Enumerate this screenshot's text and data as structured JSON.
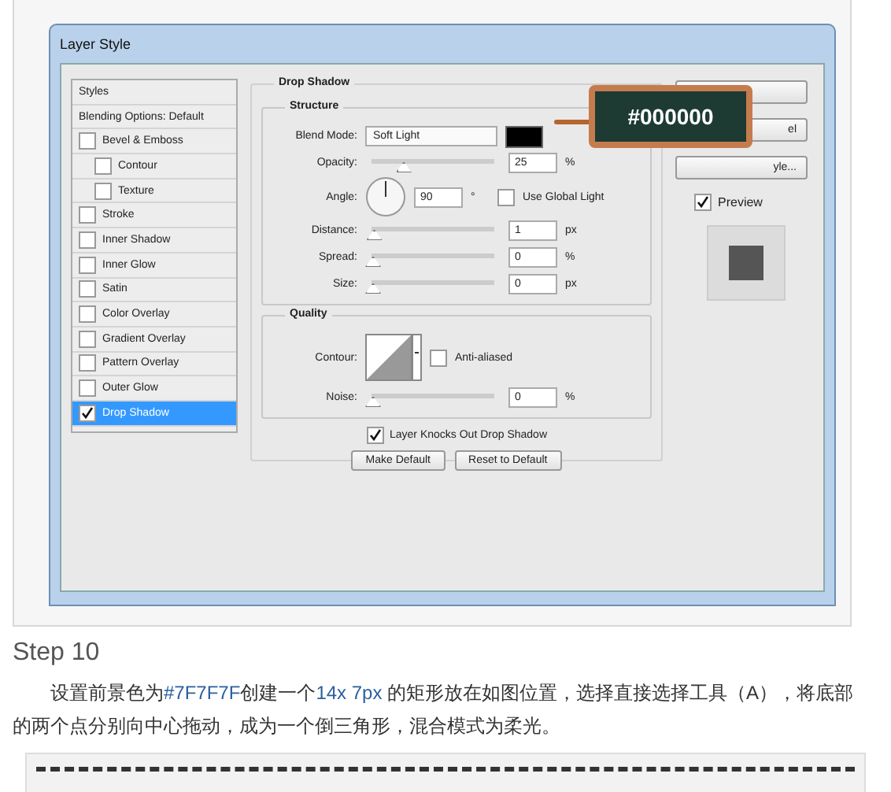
{
  "dialog": {
    "title": "Layer Style",
    "styles_header": "Styles",
    "blending_options": "Blending Options: Default",
    "style_items": [
      {
        "label": "Bevel & Emboss",
        "checked": false,
        "selected": false,
        "children": [
          {
            "label": "Contour",
            "checked": false,
            "selected": false
          },
          {
            "label": "Texture",
            "checked": false,
            "selected": false
          }
        ]
      },
      {
        "label": "Stroke",
        "checked": false,
        "selected": false
      },
      {
        "label": "Inner Shadow",
        "checked": false,
        "selected": false
      },
      {
        "label": "Inner Glow",
        "checked": false,
        "selected": false
      },
      {
        "label": "Satin",
        "checked": false,
        "selected": false
      },
      {
        "label": "Color Overlay",
        "checked": false,
        "selected": false
      },
      {
        "label": "Gradient Overlay",
        "checked": false,
        "selected": false
      },
      {
        "label": "Pattern Overlay",
        "checked": false,
        "selected": false
      },
      {
        "label": "Outer Glow",
        "checked": false,
        "selected": false
      },
      {
        "label": "Drop Shadow",
        "checked": true,
        "selected": true
      }
    ],
    "section_title": "Drop Shadow",
    "structure": {
      "title": "Structure",
      "rows": [
        {
          "kind": "dropdown",
          "label": "Blend Mode:",
          "value": "Soft Light"
        },
        {
          "kind": "slider",
          "label": "Opacity:",
          "level": 0.25,
          "value": "25",
          "unit": "%"
        },
        {
          "kind": "angle",
          "label": "Angle:",
          "value": "90",
          "unit": "°",
          "option": {
            "label": "Use Global Light",
            "checked": false
          }
        },
        {
          "kind": "slider",
          "label": "Distance:",
          "level": 0.01,
          "value": "1",
          "unit": "px"
        },
        {
          "kind": "slider",
          "label": "Spread:",
          "level": 0,
          "value": "0",
          "unit": "%"
        },
        {
          "kind": "slider",
          "label": "Size:",
          "level": 0,
          "value": "0",
          "unit": "px"
        }
      ]
    },
    "quality": {
      "title": "Quality",
      "contour_label": "Contour:",
      "anti_aliased": {
        "label": "Anti-aliased",
        "checked": false
      },
      "noise": {
        "label": "Noise:",
        "level": 0,
        "value": "0",
        "unit": "%"
      }
    },
    "knockout": {
      "label": "Layer Knocks Out Drop Shadow",
      "checked": true
    },
    "buttons": [
      "Make Default",
      "Reset to Default"
    ],
    "side_buttons": [
      "el",
      "yle..."
    ],
    "preview": {
      "label": "Preview",
      "checked": true
    },
    "callout": "#000000"
  },
  "article": {
    "step_title": "Step 10",
    "paragraph": [
      {
        "kind": "plain",
        "text": "设置前景色为"
      },
      {
        "kind": "highlight",
        "text": "#7F7F7F"
      },
      {
        "kind": "plain",
        "text": "创建一个"
      },
      {
        "kind": "highlight",
        "text": "14x 7px"
      },
      {
        "kind": "plain",
        "text": " 的矩形放在如图位置，选择直接选择工具（A），将底部的两个点分别向中心拖动，成为一个倒三角形，混合模式为柔光。"
      }
    ]
  }
}
